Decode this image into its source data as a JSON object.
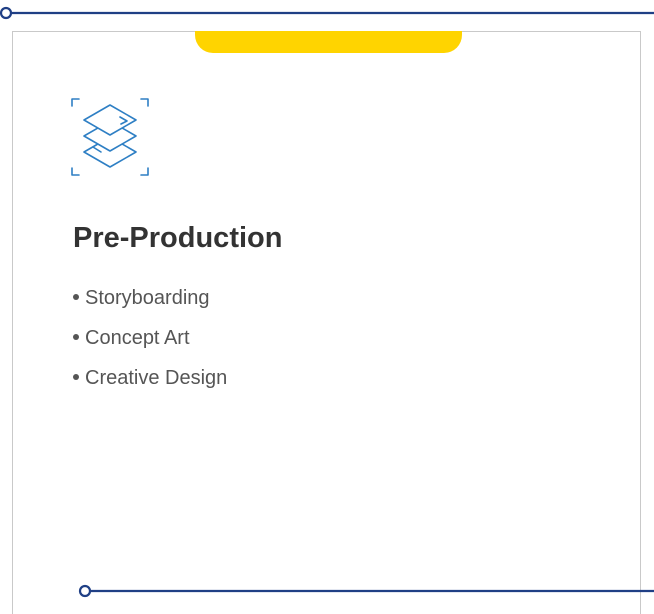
{
  "card": {
    "icon": "stacked-layers-icon",
    "title": "Pre-Production",
    "features": [
      "Storyboarding",
      "Concept Art",
      "Creative Design"
    ]
  },
  "colors": {
    "accent": "#ffd400",
    "timeline": "#1f3f85",
    "icon": "#2e7fc4",
    "title": "#333333",
    "text": "#555555"
  }
}
